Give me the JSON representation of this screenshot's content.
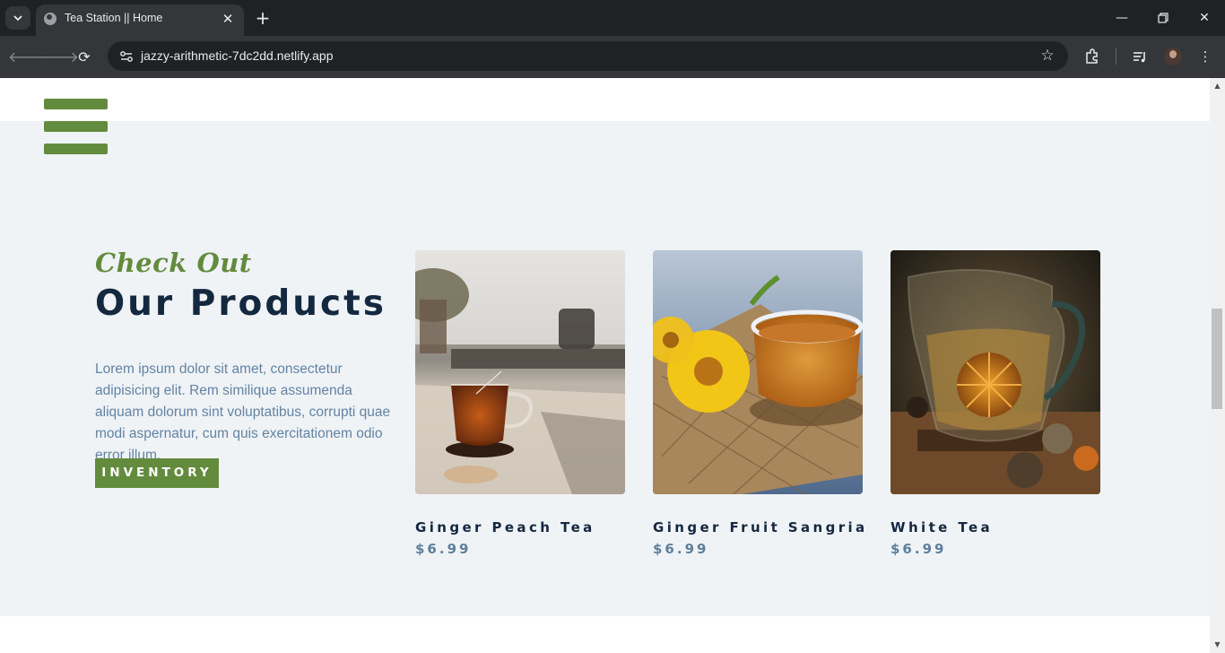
{
  "browser": {
    "tab_title": "Tea Station || Home",
    "url": "jazzy-arithmetic-7dc2dd.netlify.app"
  },
  "section": {
    "kicker": "Check Out",
    "heading": "Our Products",
    "description": "Lorem ipsum dolor sit amet, consectetur adipisicing elit. Rem similique assumenda aliquam dolorum sint voluptatibus, corrupti quae modi aspernatur, cum quis exercitationem odio error illum.",
    "button_label": "INVENTORY"
  },
  "products": [
    {
      "name": "Ginger Peach Tea",
      "price": "$6.99"
    },
    {
      "name": "Ginger Fruit Sangria",
      "price": "$6.99"
    },
    {
      "name": "White Tea",
      "price": "$6.99"
    }
  ],
  "colors": {
    "accent_green": "#638b3d",
    "heading_navy": "#142840",
    "text_blue": "#6383a2",
    "section_bg": "#eff3f6"
  }
}
